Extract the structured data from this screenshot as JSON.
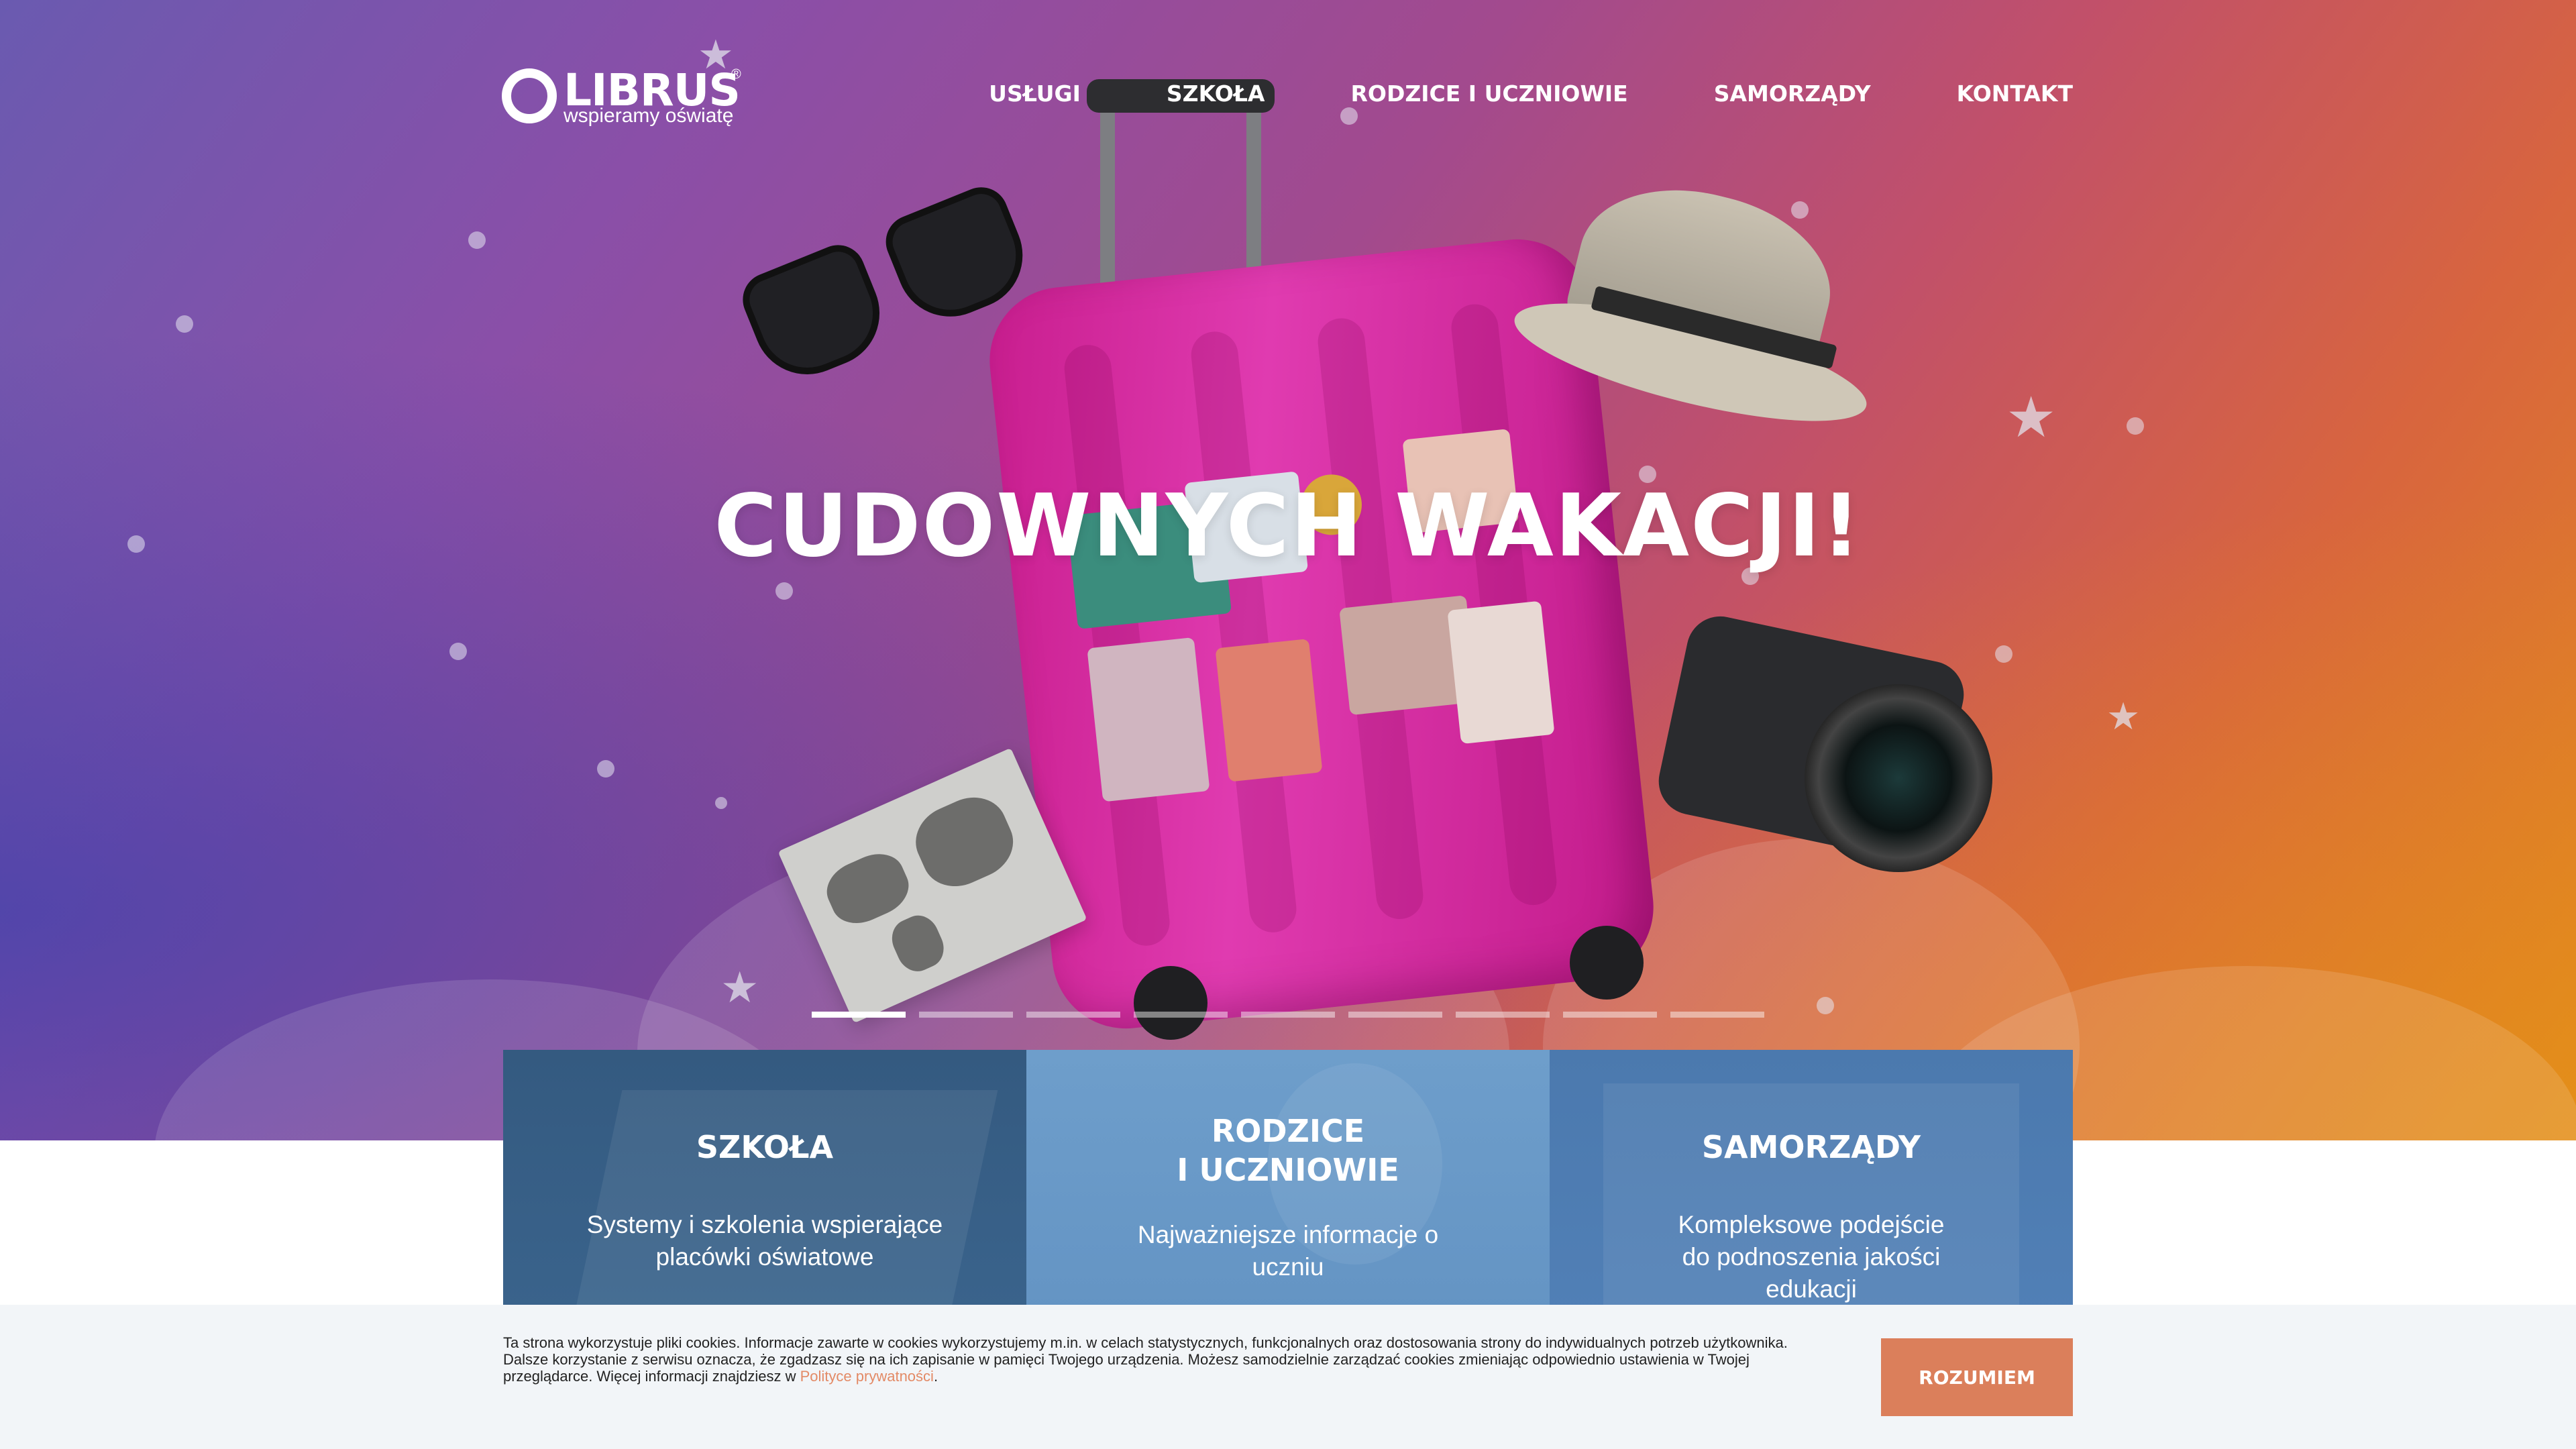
{
  "brand": {
    "name": "LIBRUS",
    "registered": "®",
    "tagline": "wspieramy oświatę"
  },
  "nav": {
    "items": [
      {
        "label": "USŁUGI"
      },
      {
        "label": "SZKOŁA"
      },
      {
        "label": "RODZICE I UCZNIOWIE"
      },
      {
        "label": "SAMORZĄDY"
      },
      {
        "label": "KONTAKT"
      }
    ]
  },
  "hero": {
    "headline": "CUDOWNYCH WAKACJI!",
    "slides_total": 9,
    "active_slide": 1
  },
  "tiles": [
    {
      "title_line1": "SZKOŁA",
      "title_line2": "",
      "desc": "Systemy i szkolenia wspierające placówki oświatowe"
    },
    {
      "title_line1": "RODZICE",
      "title_line2": "I UCZNIOWIE",
      "desc": "Najważniejsze informacje o uczniu"
    },
    {
      "title_line1": "SAMORZĄDY",
      "title_line2": "",
      "desc": "Kompleksowe podejście do podnoszenia jakości edukacji"
    }
  ],
  "cookie": {
    "text": "Ta strona wykorzystuje pliki cookies. Informacje zawarte w cookies wykorzystujemy m.in. w celach statystycznych, funkcjonalnych oraz dostosowania strony do indywidualnych potrzeb użytkownika. Dalsze korzystanie z serwisu oznacza, że zgadzasz się na ich zapisanie w pamięci Twojego urządzenia. Możesz samodzielnie zarządzać cookies zmieniając odpowiednio ustawienia w Twojej przeglądarce. Więcej informacji znajdziesz w",
    "link_label": "Polityce prywatności",
    "after_link": ".",
    "accept_label": "ROZUMIEM"
  },
  "colors": {
    "accent": "#db7f5b",
    "link": "#e38a66",
    "suitcase": "#d42da0"
  }
}
